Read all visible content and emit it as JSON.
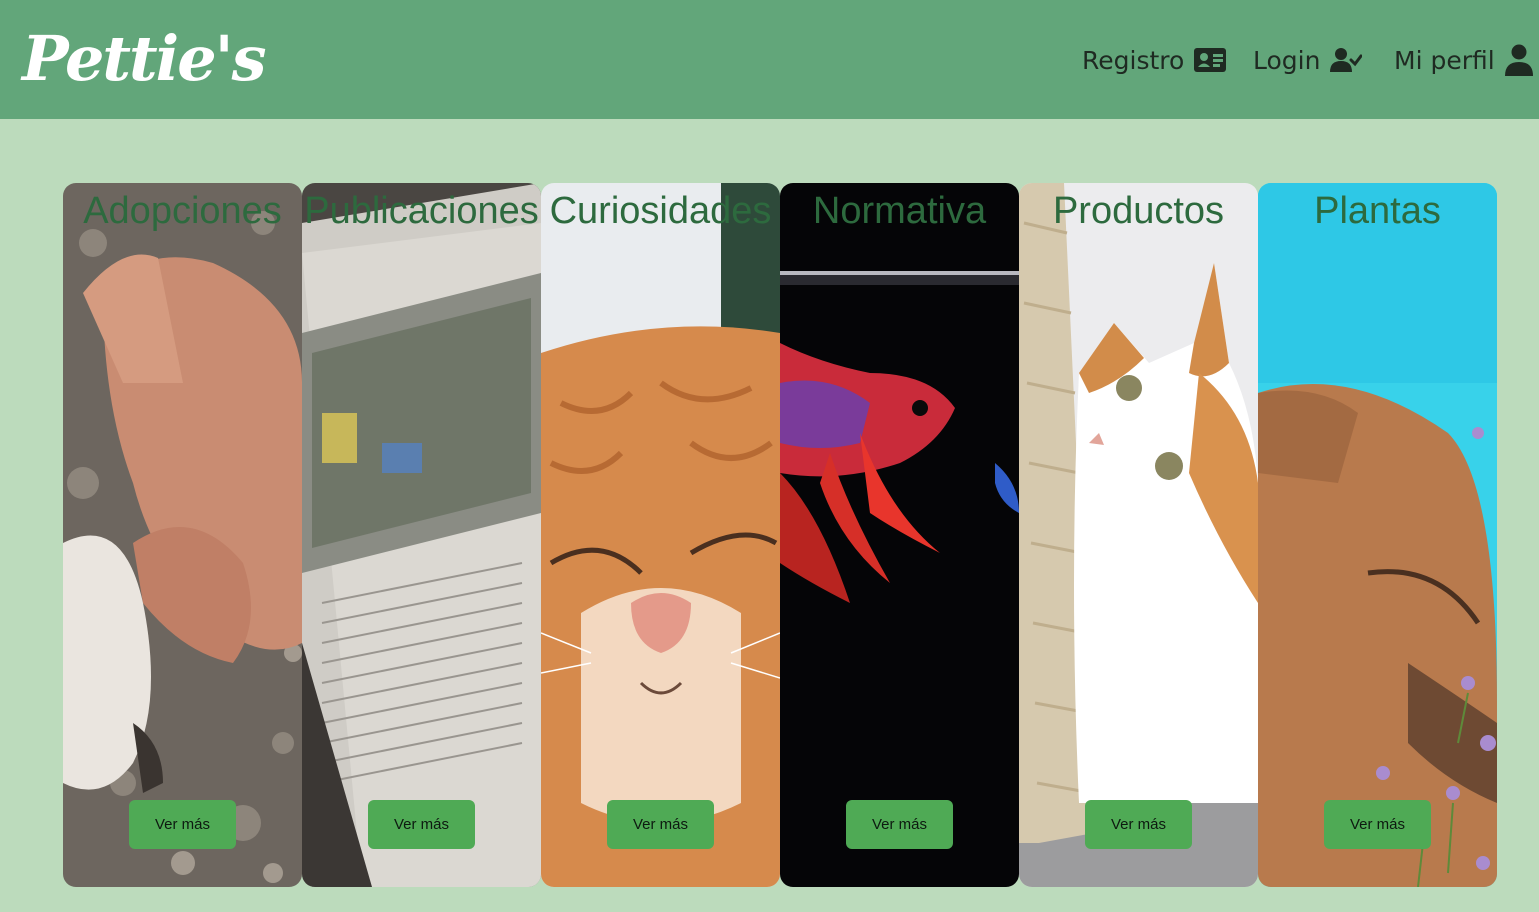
{
  "brand": {
    "logo_text": "Pettie's"
  },
  "nav": {
    "registro_label": "Registro",
    "login_label": "Login",
    "perfil_label": "Mi perfil"
  },
  "cards": [
    {
      "title": "Adopciones",
      "button": "Ver más",
      "image": "hand-and-dog-paw"
    },
    {
      "title": "Publicaciones",
      "button": "Ver más",
      "image": "newspaper"
    },
    {
      "title": "Curiosidades",
      "button": "Ver más",
      "image": "sleeping-orange-cat"
    },
    {
      "title": "Normativa",
      "button": "Ver más",
      "image": "betta-fish"
    },
    {
      "title": "Productos",
      "button": "Ver más",
      "image": "cat-with-scratching-post"
    },
    {
      "title": "Plantas",
      "button": "Ver más",
      "image": "dog-smelling-flowers"
    }
  ],
  "colors": {
    "navbar": "#62a67a",
    "page_background": "#bcdbbc",
    "button": "#4faa55",
    "card_title": "#2d6a3e"
  }
}
